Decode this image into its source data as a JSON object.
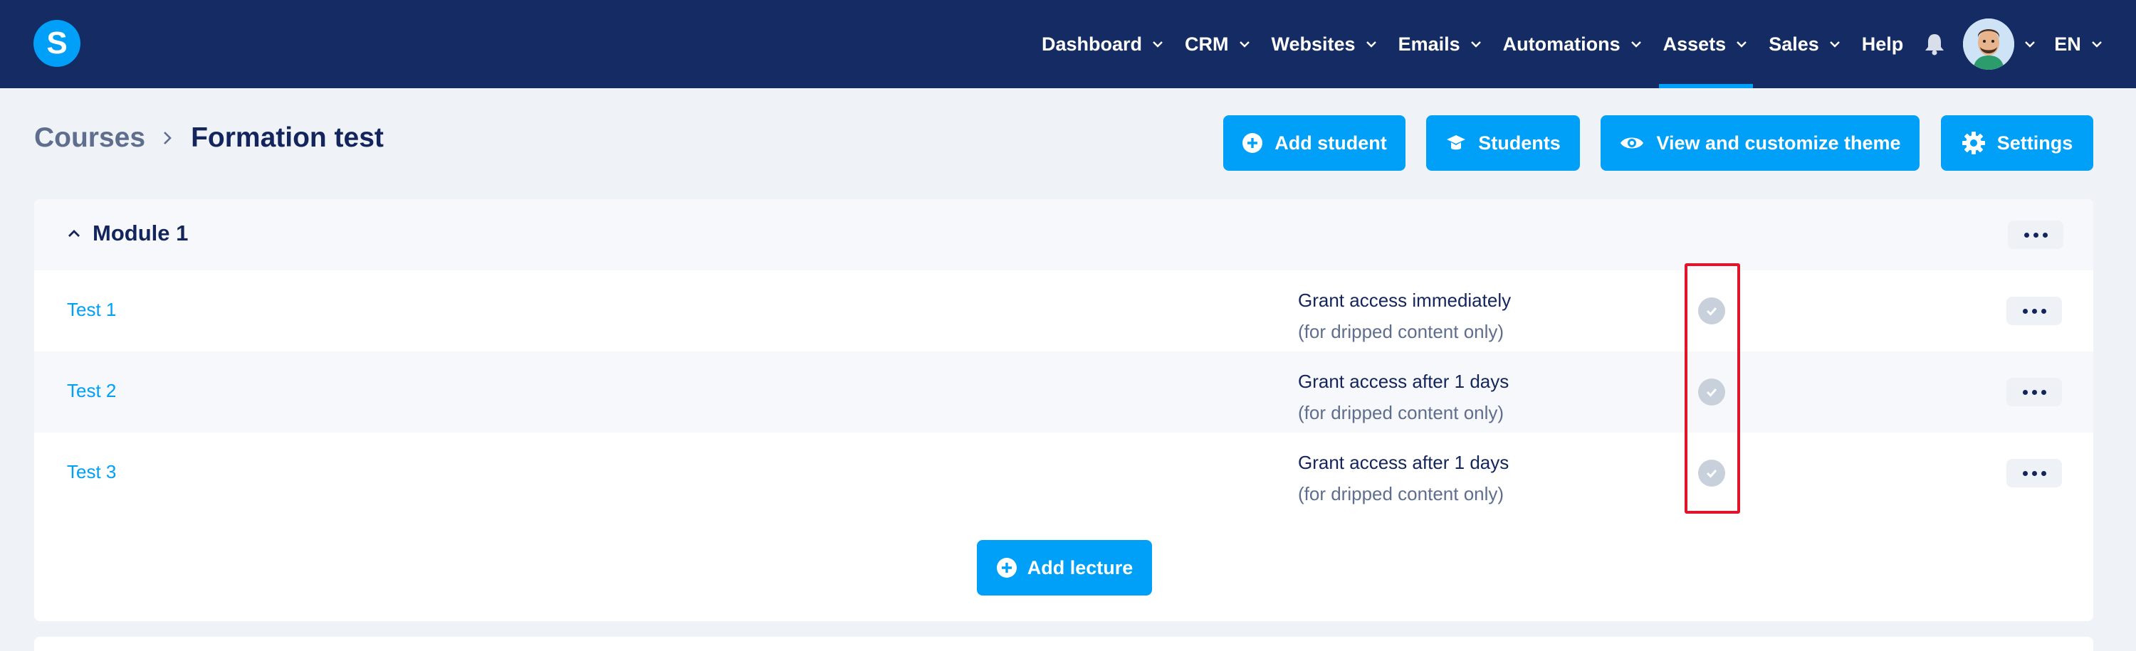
{
  "app": {
    "logo_letter": "S"
  },
  "nav": {
    "items": [
      {
        "label": "Dashboard"
      },
      {
        "label": "CRM"
      },
      {
        "label": "Websites"
      },
      {
        "label": "Emails"
      },
      {
        "label": "Automations"
      },
      {
        "label": "Assets"
      },
      {
        "label": "Sales"
      },
      {
        "label": "Help"
      }
    ],
    "active": "Assets",
    "language": "EN"
  },
  "breadcrumb": {
    "parent": "Courses",
    "current": "Formation test"
  },
  "actions": {
    "add_student": "Add student",
    "students": "Students",
    "view_theme": "View and customize theme",
    "settings": "Settings"
  },
  "module": {
    "title": "Module 1",
    "lectures": [
      {
        "title": "Test 1",
        "access": "Grant access immediately",
        "note": "(for dripped content only)"
      },
      {
        "title": "Test 2",
        "access": "Grant access after 1 days",
        "note": "(for dripped content only)"
      },
      {
        "title": "Test 3",
        "access": "Grant access after 1 days",
        "note": "(for dripped content only)"
      }
    ],
    "add_lecture": "Add lecture"
  },
  "colors": {
    "nav_bg": "#142c63",
    "accent": "#00a0f8",
    "highlight": "#e0142b"
  },
  "icons": [
    "logo",
    "chevron-down-icon",
    "bell-icon",
    "avatar",
    "chevron-right-icon",
    "plus-circle-icon",
    "graduation-cap-icon",
    "eye-icon",
    "gear-icon",
    "chevron-up-icon",
    "more-icon",
    "check-circle-icon"
  ]
}
